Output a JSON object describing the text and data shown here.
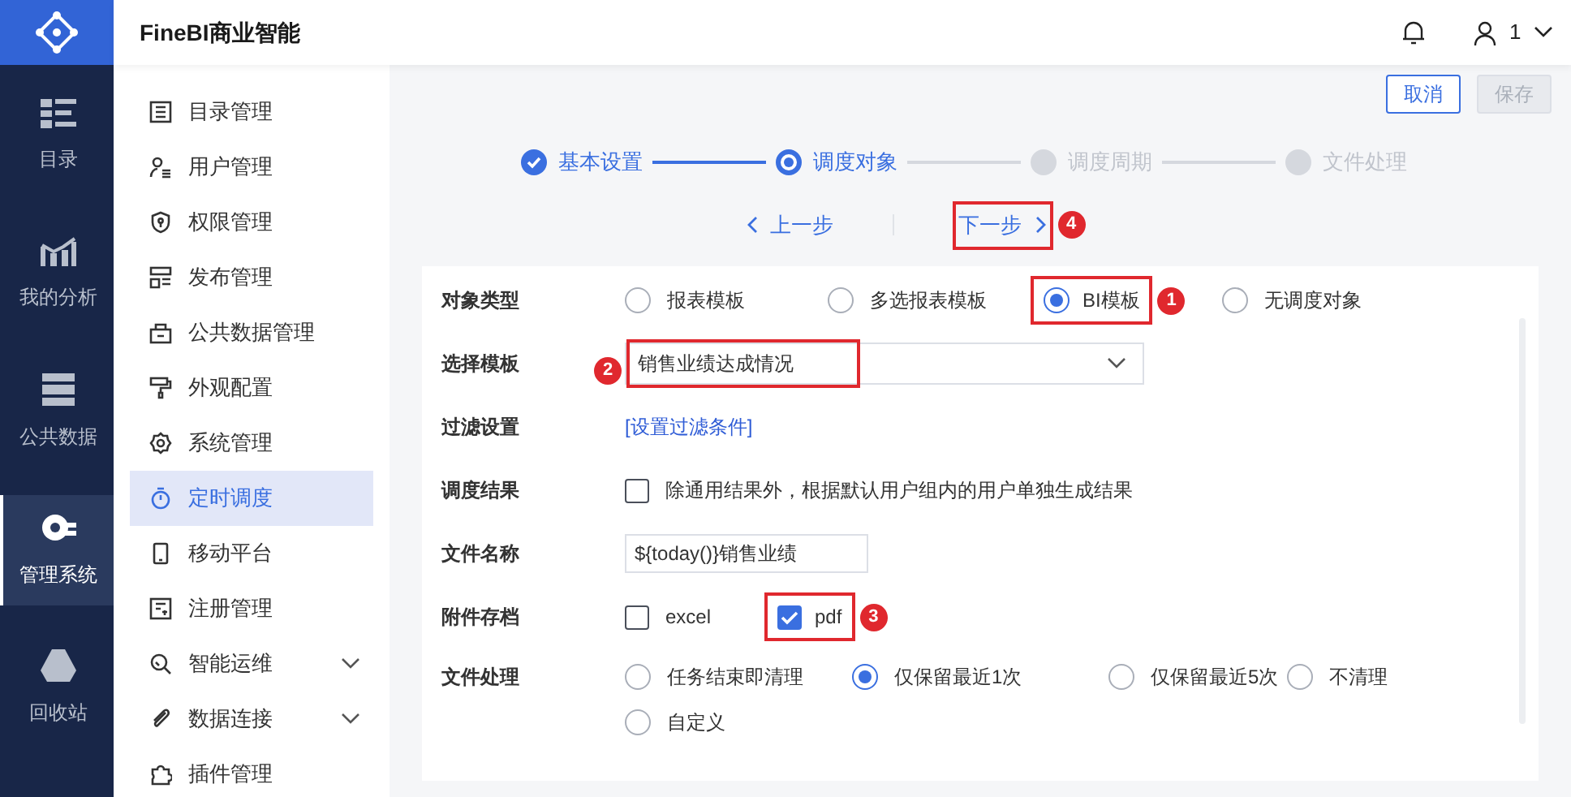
{
  "app_title": "FineBI商业智能",
  "header": {
    "user": "1"
  },
  "rail": [
    {
      "label": "目录",
      "selected": false
    },
    {
      "label": "我的分析",
      "selected": false
    },
    {
      "label": "公共数据",
      "selected": false
    },
    {
      "label": "管理系统",
      "selected": true
    },
    {
      "label": "回收站",
      "selected": false
    }
  ],
  "sidebar": [
    {
      "label": "目录管理",
      "selected": false,
      "expandable": false
    },
    {
      "label": "用户管理",
      "selected": false,
      "expandable": false
    },
    {
      "label": "权限管理",
      "selected": false,
      "expandable": false
    },
    {
      "label": "发布管理",
      "selected": false,
      "expandable": false
    },
    {
      "label": "公共数据管理",
      "selected": false,
      "expandable": false
    },
    {
      "label": "外观配置",
      "selected": false,
      "expandable": false
    },
    {
      "label": "系统管理",
      "selected": false,
      "expandable": false
    },
    {
      "label": "定时调度",
      "selected": true,
      "expandable": false
    },
    {
      "label": "移动平台",
      "selected": false,
      "expandable": false
    },
    {
      "label": "注册管理",
      "selected": false,
      "expandable": false
    },
    {
      "label": "智能运维",
      "selected": false,
      "expandable": true
    },
    {
      "label": "数据连接",
      "selected": false,
      "expandable": true
    },
    {
      "label": "插件管理",
      "selected": false,
      "expandable": false
    }
  ],
  "actions": [
    {
      "label": "取消",
      "disabled": false
    },
    {
      "label": "保存",
      "disabled": true
    }
  ],
  "steps": [
    {
      "label": "基本设置",
      "selected": false
    },
    {
      "label": "调度对象",
      "selected": true
    },
    {
      "label": "调度周期",
      "selected": false
    },
    {
      "label": "文件处理",
      "selected": false
    }
  ],
  "nav": {
    "prev": "上一步",
    "next": "下一步",
    "next_callout": "4"
  },
  "form": [
    {
      "kind": "radio",
      "label": "对象类型",
      "options": [
        {
          "label": "报表模板",
          "selected": false
        },
        {
          "label": "多选报表模板",
          "selected": false
        },
        {
          "label": "BI模板",
          "selected": true,
          "callout": "1"
        },
        {
          "label": "无调度对象",
          "selected": false
        }
      ]
    },
    {
      "kind": "select",
      "label": "选择模板",
      "value": "销售业绩达成情况",
      "callout": "2"
    },
    {
      "kind": "link",
      "label": "过滤设置",
      "value": "[设置过滤条件]"
    },
    {
      "kind": "checkbox",
      "label": "调度结果",
      "options": [
        {
          "label": "除通用结果外，根据默认用户组内的用户单独生成结果",
          "checked": false
        }
      ]
    },
    {
      "kind": "input",
      "label": "文件名称",
      "value": "${today()}销售业绩"
    },
    {
      "kind": "checkbox",
      "label": "附件存档",
      "options": [
        {
          "label": "excel",
          "checked": false
        },
        {
          "label": "pdf",
          "checked": true,
          "callout": "3"
        }
      ]
    },
    {
      "kind": "radio",
      "label": "文件处理",
      "options": [
        {
          "label": "任务结束即清理",
          "selected": false
        },
        {
          "label": "仅保留最近1次",
          "selected": true
        },
        {
          "label": "仅保留最近5次",
          "selected": false
        },
        {
          "label": "不清理",
          "selected": false
        },
        {
          "label": "自定义",
          "selected": false
        }
      ]
    }
  ]
}
